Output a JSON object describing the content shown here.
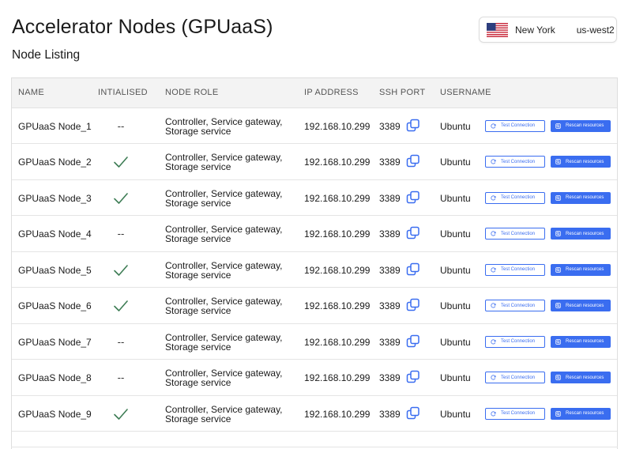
{
  "header": {
    "title": "Accelerator Nodes (GPUaaS)",
    "subtitle": "Node Listing"
  },
  "region_selector": {
    "flag_icon": "us-flag-icon",
    "city": "New York",
    "region": "us-west2"
  },
  "table": {
    "columns": [
      "NAME",
      "INTIALISED",
      "NODE ROLE",
      "IP ADDRESS",
      "SSH PORT",
      "USERNAME"
    ],
    "rows": [
      {
        "name": "GPUaaS Node_1",
        "initialised": false,
        "role_line1": "Controller, Service gateway,",
        "role_line2": "Storage service",
        "ip": "192.168.10.299",
        "port": "3389",
        "username": "Ubuntu",
        "test_label": "Test Connection",
        "rescan_label": "Rescan resources"
      },
      {
        "name": "GPUaaS Node_2",
        "initialised": true,
        "role_line1": "Controller, Service gateway,",
        "role_line2": "Storage service",
        "ip": "192.168.10.299",
        "port": "3389",
        "username": "Ubuntu",
        "test_label": "Test Connection",
        "rescan_label": "Rescan resources"
      },
      {
        "name": "GPUaaS Node_3",
        "initialised": true,
        "role_line1": "Controller, Service gateway,",
        "role_line2": "Storage service",
        "ip": "192.168.10.299",
        "port": "3389",
        "username": "Ubuntu",
        "test_label": "Test Connection",
        "rescan_label": "Rescan resources"
      },
      {
        "name": "GPUaaS Node_4",
        "initialised": false,
        "role_line1": "Controller, Service gateway,",
        "role_line2": "Storage service",
        "ip": "192.168.10.299",
        "port": "3389",
        "username": "Ubuntu",
        "test_label": "Test Connection",
        "rescan_label": "Rescan resources"
      },
      {
        "name": "GPUaaS Node_5",
        "initialised": true,
        "role_line1": "Controller, Service gateway,",
        "role_line2": "Storage service",
        "ip": "192.168.10.299",
        "port": "3389",
        "username": "Ubuntu",
        "test_label": "Test Connection",
        "rescan_label": "Rescan resources"
      },
      {
        "name": "GPUaaS Node_6",
        "initialised": true,
        "role_line1": "Controller, Service gateway,",
        "role_line2": "Storage service",
        "ip": "192.168.10.299",
        "port": "3389",
        "username": "Ubuntu",
        "test_label": "Test Connection",
        "rescan_label": "Rescan resources"
      },
      {
        "name": "GPUaaS Node_7",
        "initialised": false,
        "role_line1": "Controller, Service gateway,",
        "role_line2": "Storage service",
        "ip": "192.168.10.299",
        "port": "3389",
        "username": "Ubuntu",
        "test_label": "Test Connection",
        "rescan_label": "Rescan resources"
      },
      {
        "name": "GPUaaS Node_8",
        "initialised": false,
        "role_line1": "Controller, Service gateway,",
        "role_line2": "Storage service",
        "ip": "192.168.10.299",
        "port": "3389",
        "username": "Ubuntu",
        "test_label": "Test Connection",
        "rescan_label": "Rescan resources"
      },
      {
        "name": "GPUaaS Node_9",
        "initialised": true,
        "role_line1": "Controller, Service gateway,",
        "role_line2": "Storage service",
        "ip": "192.168.10.299",
        "port": "3389",
        "username": "Ubuntu",
        "test_label": "Test Connection",
        "rescan_label": "Rescan resources"
      }
    ],
    "not_initialised_text": "--",
    "initialised_icon": "checkmark-icon",
    "copy_icon": "copy-icon",
    "test_icon": "refresh-icon",
    "rescan_icon": "scan-icon"
  },
  "colors": {
    "accent": "#3a6df0",
    "check": "#3e7d55",
    "header_bg": "#f3f3f3"
  }
}
